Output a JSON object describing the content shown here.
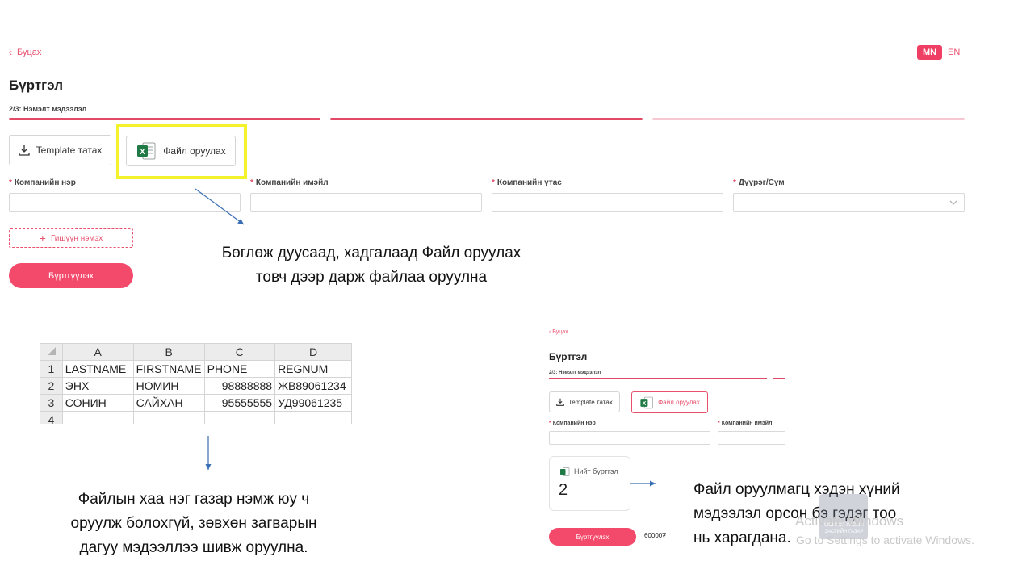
{
  "form": {
    "back_label": "Буцах",
    "lang_mn": "MN",
    "lang_en": "EN",
    "title": "Бүртгэл",
    "step_label": "2/3: Нэмэлт мэдээлэл",
    "template_button": "Template татах",
    "file_button": "Файл оруулах",
    "fields": [
      {
        "label": "Компанийн нэр",
        "required": "*"
      },
      {
        "label": "Компанийн имэйл",
        "required": "*"
      },
      {
        "label": "Компанийн утас",
        "required": "*"
      },
      {
        "label": "Дүүрэг/Сум",
        "required": "*"
      }
    ],
    "add_member_label": "Гишүүн нэмэх",
    "register_label": "Бүртгүүлэх"
  },
  "captions": {
    "upload_line1": "Бөглөж дуусаад, хадгалаад Файл оруулах",
    "upload_line2": "товч дээр дарж файлаа оруулна",
    "warning_line1": "Файлын хаа нэг газар нэмж юу ч",
    "warning_line2": "оруулж болохгүй, зөвхөн загварын",
    "warning_line3": "дагуу мэдээллээ шивж оруулна.",
    "count_line1": "Файл оруулмагц хэдэн хүний",
    "count_line2": "мэдээлэл орсон бэ гэдэг тоо",
    "count_line3": "нь харагдана."
  },
  "spreadsheet": {
    "columns": [
      "A",
      "B",
      "C",
      "D"
    ],
    "rows": [
      {
        "num": "1",
        "cells": [
          "LASTNAME",
          "FIRSTNAME",
          "PHONE",
          "REGNUM"
        ]
      },
      {
        "num": "2",
        "cells": [
          "ЭНХ",
          "НОМИН",
          "98888888",
          "ЖВ89061234"
        ]
      },
      {
        "num": "3",
        "cells": [
          "СОНИН",
          "САЙХАН",
          "95555555",
          "УД99061235"
        ]
      },
      {
        "num": "4",
        "cells": [
          "",
          "",
          "",
          ""
        ]
      }
    ]
  },
  "preview": {
    "back_label": "Буцах",
    "title": "Бүртгэл",
    "step_label": "2/3: Нэмэлт мэдээлэл",
    "template_button": "Template татах",
    "file_button": "Файл оруулах",
    "field1": "Компанийн нэр",
    "field2": "Компанийн имэйл",
    "required": "*",
    "total_label": "Нийт бүртгэл",
    "total_value": "2",
    "register_label": "Бүртгүүлэх",
    "price": "60000₮"
  },
  "watermark": {
    "line1": "Activate Windows",
    "line2": "Go to Settings to activate Windows.",
    "emblem_line1": "МОНГОЛ УЛСЫН",
    "emblem_line2": "ЗАСГИЙН ГАЗАР"
  },
  "colors": {
    "accent": "#f34a6b",
    "highlight": "#f3f32c",
    "arrow": "#3a6fb5"
  }
}
